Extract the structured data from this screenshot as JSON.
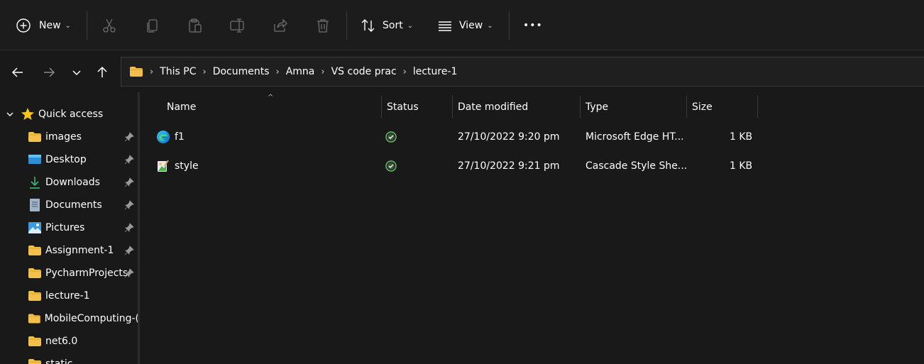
{
  "toolbar": {
    "new_label": "New",
    "sort_label": "Sort",
    "view_label": "View",
    "more_label": "•••"
  },
  "address": {
    "crumbs": [
      "This PC",
      "Documents",
      "Amna",
      "VS code prac",
      "lecture-1"
    ]
  },
  "sidebar": {
    "quick_access_label": "Quick access",
    "items": [
      {
        "label": "images",
        "icon": "folder-icon",
        "pinned": true
      },
      {
        "label": "Desktop",
        "icon": "desktop-icon",
        "pinned": true
      },
      {
        "label": "Downloads",
        "icon": "download-icon",
        "pinned": true
      },
      {
        "label": "Documents",
        "icon": "document-icon",
        "pinned": true
      },
      {
        "label": "Pictures",
        "icon": "pictures-icon",
        "pinned": true
      },
      {
        "label": "Assignment-1",
        "icon": "folder-icon",
        "pinned": true
      },
      {
        "label": "PycharmProjects",
        "icon": "folder-icon",
        "pinned": true
      },
      {
        "label": "lecture-1",
        "icon": "folder-icon",
        "pinned": false
      },
      {
        "label": "MobileComputing-(",
        "icon": "folder-icon",
        "pinned": false
      },
      {
        "label": "net6.0",
        "icon": "folder-icon",
        "pinned": false
      },
      {
        "label": "static",
        "icon": "folder-icon",
        "pinned": false
      }
    ]
  },
  "columns": {
    "name": "Name",
    "status": "Status",
    "date": "Date modified",
    "type": "Type",
    "size": "Size"
  },
  "files": [
    {
      "name": "f1",
      "icon": "edge-html-icon",
      "status": "synced",
      "date": "27/10/2022 9:20 pm",
      "type": "Microsoft Edge HT...",
      "size": "1 KB"
    },
    {
      "name": "style",
      "icon": "css-file-icon",
      "status": "synced",
      "date": "27/10/2022 9:21 pm",
      "type": "Cascade Style She...",
      "size": "1 KB"
    }
  ],
  "colors": {
    "background": "#191919",
    "folder_yellow": "#f3c14b",
    "status_green": "#6cc36c",
    "star": "#f5c518"
  }
}
